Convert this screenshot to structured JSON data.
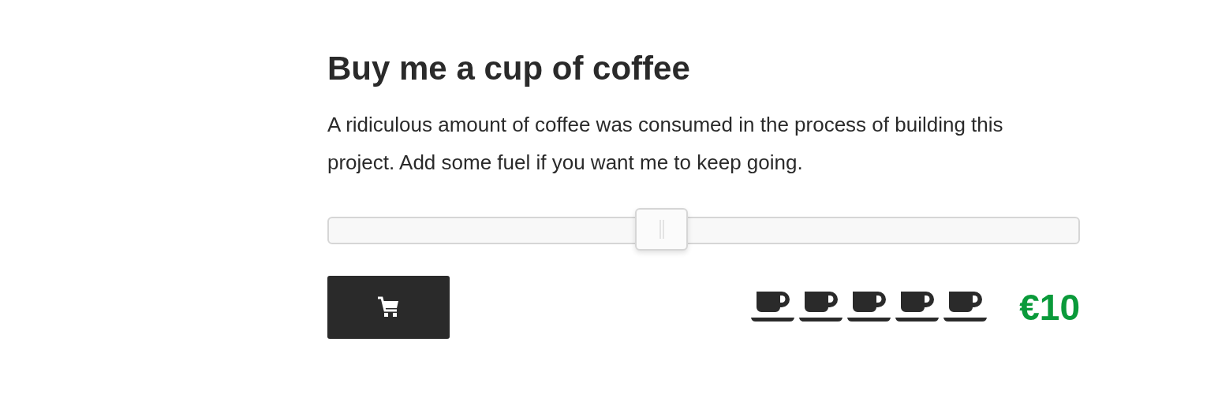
{
  "title": "Buy me a cup of coffee",
  "description": "A ridiculous amount of coffee was consumed in the process of building this project. Add some fuel if you want me to keep going.",
  "slider": {
    "level": 0.44
  },
  "cups": {
    "stars": 5
  },
  "price": "€10"
}
